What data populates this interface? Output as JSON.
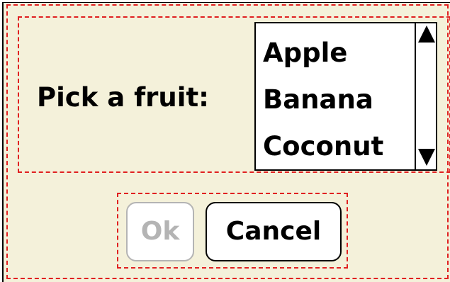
{
  "dialog": {
    "prompt_label": "Pick a fruit:",
    "list": {
      "items": [
        "Apple",
        "Banana",
        "Coconut"
      ]
    },
    "buttons": {
      "ok_label": "Ok",
      "ok_enabled": false,
      "cancel_label": "Cancel"
    }
  },
  "colors": {
    "background": "#f4f1da",
    "debug_outline": "#e02020",
    "disabled_text": "#b4b4b4"
  },
  "icons": {
    "scroll_up": "triangle-up-icon",
    "scroll_down": "triangle-down-icon"
  }
}
